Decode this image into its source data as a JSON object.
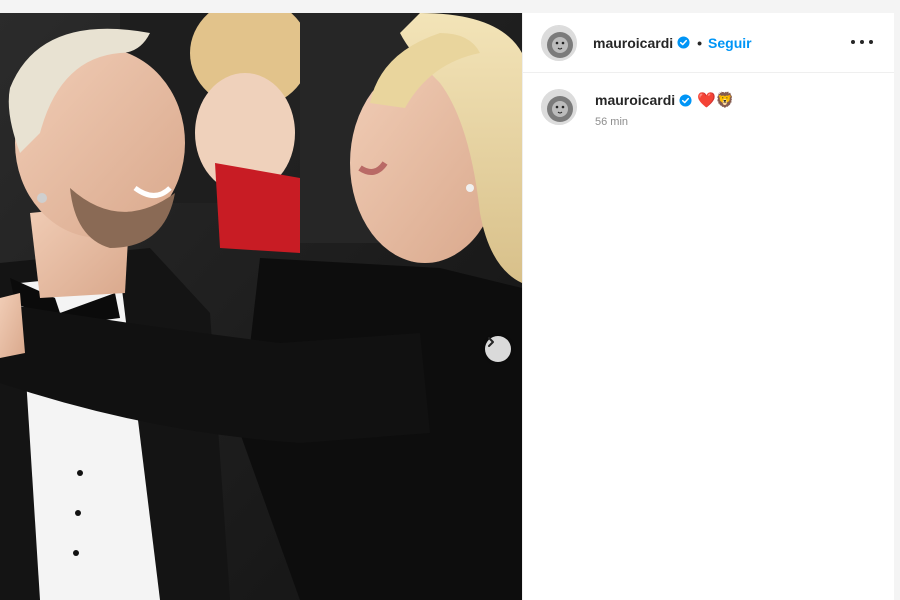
{
  "post": {
    "username": "mauroicardi",
    "separator": "•",
    "follow_label": "Seguir",
    "more_icon": "more-horizontal-icon",
    "verified_icon": "verified-badge-icon",
    "next_icon": "chevron-right-icon",
    "comment": {
      "username": "mauroicardi",
      "caption": "❤️🦁",
      "time": "56 min"
    },
    "colors": {
      "link": "#0095f6",
      "text": "#262626",
      "muted": "#8e8e8e",
      "divider": "#efefef"
    }
  }
}
